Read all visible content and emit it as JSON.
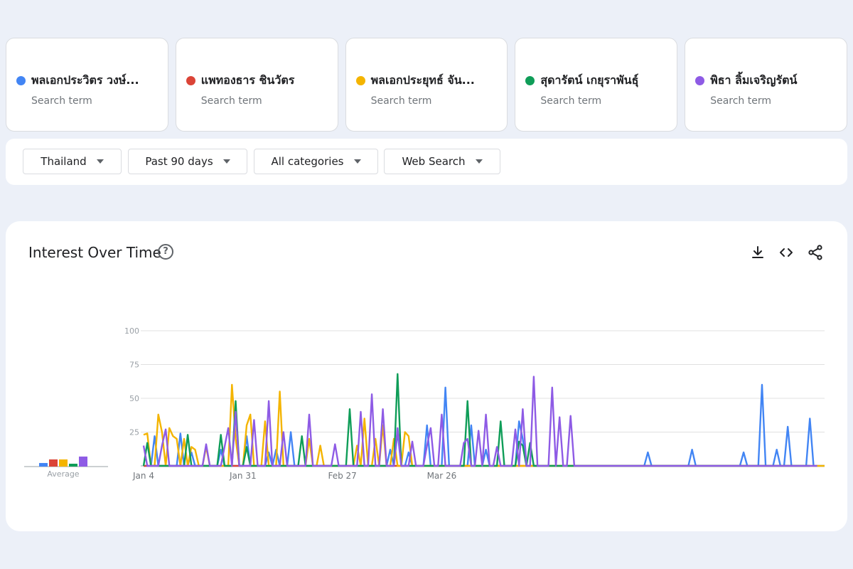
{
  "terms": [
    {
      "name": "พลเอกประวิตร วงษ์...",
      "sub": "Search term",
      "color": "#4285F4"
    },
    {
      "name": "แพทองธาร ชินวัตร",
      "sub": "Search term",
      "color": "#DB4437"
    },
    {
      "name": "พลเอกประยุทธ์ จัน...",
      "sub": "Search term",
      "color": "#F4B400"
    },
    {
      "name": "สุดารัตน์ เกยุราพันธุ์",
      "sub": "Search term",
      "color": "#0F9D58"
    },
    {
      "name": "พิธา ลิ้มเจริญรัตน์",
      "sub": "Search term",
      "color": "#8E5BE5"
    }
  ],
  "filters": {
    "region": "Thailand",
    "time": "Past 90 days",
    "category": "All categories",
    "search_type": "Web Search"
  },
  "chart": {
    "title": "Interest Over Time",
    "help_icon": "help-circle-icon",
    "tools": [
      "download-icon",
      "embed-code-icon",
      "share-icon"
    ]
  },
  "chart_data": {
    "type": "line",
    "ylim": [
      0,
      100
    ],
    "yticks": [
      25,
      50,
      75,
      100
    ],
    "xticks": [
      {
        "label": "Jan 4",
        "index": 0
      },
      {
        "label": "Jan 31",
        "index": 27
      },
      {
        "label": "Feb 27",
        "index": 54
      },
      {
        "label": "Mar 26",
        "index": 81
      }
    ],
    "average_label": "Average",
    "averages": [
      5,
      10,
      10,
      4,
      14
    ],
    "grid": true,
    "series": [
      {
        "name": "พลเอกประวิตร วงษ์...",
        "color": "#4285F4",
        "values": [
          0,
          0,
          0,
          22,
          0,
          0,
          0,
          0,
          0,
          0,
          24,
          0,
          0,
          10,
          0,
          0,
          0,
          0,
          0,
          0,
          0,
          12,
          0,
          0,
          0,
          0,
          0,
          0,
          22,
          0,
          0,
          0,
          0,
          0,
          10,
          0,
          12,
          0,
          0,
          0,
          25,
          0,
          0,
          0,
          0,
          0,
          0,
          0,
          0,
          0,
          0,
          0,
          0,
          0,
          0,
          0,
          0,
          0,
          0,
          0,
          0,
          0,
          0,
          0,
          0,
          0,
          0,
          12,
          0,
          25,
          0,
          0,
          10,
          0,
          0,
          0,
          0,
          30,
          0,
          0,
          0,
          0,
          58,
          0,
          0,
          0,
          0,
          0,
          0,
          30,
          0,
          0,
          0,
          12,
          0,
          0,
          0,
          0,
          0,
          0,
          0,
          0,
          33,
          20,
          0,
          0,
          0,
          0,
          0,
          0,
          0,
          0,
          0,
          0,
          0,
          0,
          0,
          0,
          0,
          0,
          0,
          0,
          0,
          0,
          0,
          0,
          0,
          0,
          0,
          0,
          0,
          0,
          0,
          0,
          0,
          0,
          0,
          10,
          0,
          0,
          0,
          0,
          0,
          0,
          0,
          0,
          0,
          0,
          0,
          12,
          0,
          0,
          0,
          0,
          0,
          0,
          0,
          0,
          0,
          0,
          0,
          0,
          0,
          10,
          0,
          0,
          0,
          0,
          60,
          0,
          0,
          0,
          12,
          0,
          0,
          29,
          0,
          0,
          0,
          0,
          0,
          35,
          0,
          0,
          0,
          0
        ]
      },
      {
        "name": "แพทองธาร ชินวัตร",
        "color": "#DB4437",
        "values": [
          0,
          0,
          0,
          0,
          0,
          0,
          0,
          0,
          0,
          0,
          0,
          0,
          0,
          0,
          0,
          0,
          0,
          0,
          0,
          0,
          0,
          0,
          0,
          0,
          0,
          0,
          0,
          0,
          0,
          0,
          0,
          0,
          0,
          0,
          0,
          0,
          0,
          0,
          0,
          0,
          0,
          0,
          0,
          0,
          0,
          0,
          0,
          0,
          0,
          0,
          0,
          0,
          0,
          0,
          0,
          0,
          0,
          0,
          0,
          0,
          0,
          0,
          0,
          0,
          0,
          0,
          0,
          0,
          0,
          0,
          0,
          0,
          0,
          0,
          0,
          0,
          0,
          0,
          0,
          0,
          0,
          0,
          0,
          0,
          0,
          0,
          0,
          0,
          0,
          0,
          0,
          0,
          0,
          0,
          0,
          0,
          0,
          0,
          0,
          0,
          0,
          0,
          0,
          0,
          0,
          0,
          0,
          0,
          0,
          0,
          0,
          0,
          0,
          0,
          0,
          0,
          0,
          0,
          0,
          0,
          0,
          0,
          0,
          0,
          0,
          0,
          0,
          0,
          0,
          0,
          0,
          0,
          0,
          0,
          0,
          0,
          0,
          0,
          0,
          0,
          0,
          0,
          0,
          0,
          0,
          0,
          0,
          0,
          0,
          0,
          0,
          0,
          0,
          0,
          0,
          0,
          0,
          0,
          0,
          0,
          0,
          0,
          0,
          0,
          0,
          0,
          0,
          0,
          0,
          0,
          0,
          0,
          0,
          0,
          0,
          0,
          0,
          0,
          0,
          0,
          0,
          0
        ]
      },
      {
        "name": "พลเอกประยุทธ์ จัน...",
        "color": "#F4B400",
        "values": [
          23,
          24,
          0,
          0,
          38,
          25,
          0,
          28,
          22,
          20,
          0,
          20,
          0,
          14,
          12,
          0,
          0,
          14,
          0,
          0,
          0,
          0,
          0,
          0,
          60,
          20,
          0,
          0,
          30,
          38,
          0,
          0,
          0,
          33,
          0,
          0,
          0,
          55,
          0,
          0,
          0,
          0,
          0,
          0,
          0,
          20,
          0,
          0,
          15,
          0,
          0,
          0,
          0,
          0,
          0,
          0,
          0,
          0,
          15,
          0,
          35,
          0,
          0,
          20,
          0,
          30,
          0,
          0,
          20,
          0,
          0,
          25,
          22,
          0,
          0,
          0,
          0,
          0,
          0,
          0,
          0,
          0,
          0,
          0,
          0,
          0,
          0,
          0,
          0,
          0,
          0,
          0,
          0,
          0,
          0,
          0,
          0,
          0,
          0,
          0,
          0,
          0,
          0,
          0,
          0,
          0,
          0,
          0,
          0,
          0,
          0,
          0,
          0,
          0,
          0,
          0,
          0,
          0,
          0,
          0,
          0,
          0,
          0,
          0,
          0,
          0,
          0,
          0,
          0,
          0,
          0,
          0,
          0,
          0,
          0,
          0,
          0,
          0,
          0,
          0,
          0,
          0,
          0,
          0,
          0,
          0,
          0,
          0,
          0,
          0,
          0,
          0,
          0,
          0,
          0,
          0,
          0,
          0,
          0,
          0,
          0,
          0,
          0,
          0,
          0,
          0,
          0,
          0,
          0,
          0,
          0,
          0,
          0,
          0,
          0,
          0,
          0,
          0,
          0,
          0,
          0,
          0,
          0,
          0,
          0,
          0
        ]
      },
      {
        "name": "สุดารัตน์ เกยุราพันธุ์",
        "color": "#0F9D58",
        "values": [
          0,
          17,
          0,
          0,
          0,
          0,
          0,
          0,
          0,
          0,
          0,
          0,
          23,
          0,
          0,
          0,
          0,
          0,
          0,
          0,
          0,
          23,
          0,
          0,
          0,
          48,
          0,
          0,
          14,
          0,
          0,
          0,
          0,
          0,
          0,
          0,
          0,
          0,
          0,
          0,
          0,
          0,
          0,
          22,
          0,
          0,
          0,
          0,
          0,
          0,
          0,
          0,
          0,
          0,
          0,
          0,
          42,
          0,
          0,
          0,
          0,
          0,
          0,
          0,
          0,
          0,
          0,
          0,
          0,
          68,
          0,
          0,
          0,
          0,
          0,
          0,
          0,
          0,
          0,
          0,
          0,
          0,
          0,
          0,
          0,
          0,
          0,
          0,
          48,
          0,
          0,
          0,
          0,
          0,
          0,
          0,
          0,
          33,
          0,
          0,
          0,
          0,
          18,
          15,
          0,
          17,
          0,
          0,
          0,
          0,
          0,
          0,
          0,
          0,
          0,
          0,
          0,
          0,
          0,
          0,
          0,
          0,
          0,
          0,
          0,
          0,
          0,
          0,
          0,
          0,
          0,
          0,
          0,
          0,
          0,
          0,
          0,
          0,
          0,
          0,
          0,
          0,
          0,
          0,
          0,
          0,
          0,
          0,
          0,
          0,
          0,
          0,
          0,
          0,
          0,
          0,
          0,
          0,
          0,
          0,
          0,
          0,
          0,
          0,
          0,
          0,
          0,
          0,
          0,
          0,
          0,
          0,
          0,
          0,
          0,
          0,
          0,
          0,
          0,
          0,
          0,
          0
        ]
      },
      {
        "name": "พิธา ลิ้มเจริญรัตน์",
        "color": "#8E5BE5",
        "values": [
          15,
          0,
          0,
          0,
          0,
          15,
          27,
          0,
          0,
          0,
          0,
          0,
          0,
          0,
          0,
          0,
          0,
          16,
          0,
          0,
          0,
          0,
          14,
          28,
          0,
          40,
          0,
          0,
          0,
          0,
          34,
          0,
          0,
          0,
          48,
          0,
          0,
          0,
          25,
          0,
          0,
          0,
          0,
          0,
          0,
          38,
          0,
          0,
          0,
          0,
          0,
          0,
          16,
          0,
          0,
          0,
          0,
          0,
          0,
          40,
          0,
          0,
          53,
          0,
          0,
          42,
          0,
          0,
          0,
          28,
          0,
          0,
          0,
          18,
          0,
          0,
          0,
          15,
          28,
          0,
          0,
          38,
          0,
          0,
          0,
          0,
          0,
          17,
          20,
          0,
          0,
          26,
          0,
          38,
          0,
          0,
          14,
          0,
          0,
          0,
          0,
          27,
          0,
          42,
          0,
          0,
          66,
          0,
          0,
          0,
          0,
          58,
          0,
          36,
          0,
          0,
          37,
          0,
          0,
          0,
          0,
          0,
          0,
          0,
          0,
          0,
          0,
          0,
          0,
          0,
          0,
          0,
          0,
          0,
          0,
          0,
          0,
          0,
          0,
          0,
          0,
          0,
          0,
          0,
          0,
          0,
          0,
          0,
          0,
          0,
          0,
          0,
          0,
          0,
          0,
          0,
          0,
          0,
          0,
          0,
          0,
          0,
          0,
          0,
          0,
          0,
          0,
          0,
          0,
          0,
          0,
          0,
          0,
          0,
          0,
          0,
          0,
          0,
          0,
          0,
          0,
          0,
          0,
          0
        ]
      }
    ]
  }
}
